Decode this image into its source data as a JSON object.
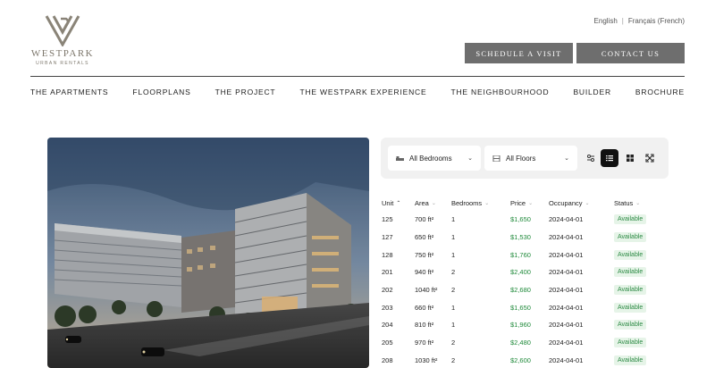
{
  "brand": {
    "name": "WESTPARK",
    "tagline": "URBAN RENTALS"
  },
  "lang": {
    "english": "English",
    "separator": "|",
    "french": "Français (French)"
  },
  "buttons": {
    "visit": "SCHEDULE A VISIT",
    "contact": "CONTACT US"
  },
  "nav": [
    "THE APARTMENTS",
    "FLOORPLANS",
    "THE PROJECT",
    "THE WESTPARK EXPERIENCE",
    "THE NEIGHBOURHOOD",
    "BUILDER",
    "BROCHURE"
  ],
  "filters": {
    "bedrooms": "All Bedrooms",
    "floors": "All Floors",
    "icons": [
      "bed-icon",
      "floor-icon",
      "chevron-down-icon",
      "settings-sliders-icon",
      "list-view-icon",
      "grid-view-icon",
      "expand-icon"
    ]
  },
  "table": {
    "headers": [
      "Unit",
      "Area",
      "Bedrooms",
      "Price",
      "Occupancy",
      "Status"
    ],
    "rows": [
      [
        "125",
        "700 ft²",
        "1",
        "$1,650",
        "2024-04-01",
        "Available"
      ],
      [
        "127",
        "650 ft²",
        "1",
        "$1,530",
        "2024-04-01",
        "Available"
      ],
      [
        "128",
        "750 ft²",
        "1",
        "$1,760",
        "2024-04-01",
        "Available"
      ],
      [
        "201",
        "940 ft²",
        "2",
        "$2,400",
        "2024-04-01",
        "Available"
      ],
      [
        "202",
        "1040 ft²",
        "2",
        "$2,680",
        "2024-04-01",
        "Available"
      ],
      [
        "203",
        "660 ft²",
        "1",
        "$1,650",
        "2024-04-01",
        "Available"
      ],
      [
        "204",
        "810 ft²",
        "1",
        "$1,960",
        "2024-04-01",
        "Available"
      ],
      [
        "205",
        "970 ft²",
        "2",
        "$2,480",
        "2024-04-01",
        "Available"
      ],
      [
        "208",
        "1030 ft²",
        "2",
        "$2,600",
        "2024-04-01",
        "Available"
      ]
    ]
  },
  "colors": {
    "button_bg": "#6e6e6e",
    "price": "#1f8a3a",
    "status_bg": "#e6f4e8",
    "status_text": "#2e8b46",
    "brand": "#7d776c"
  }
}
